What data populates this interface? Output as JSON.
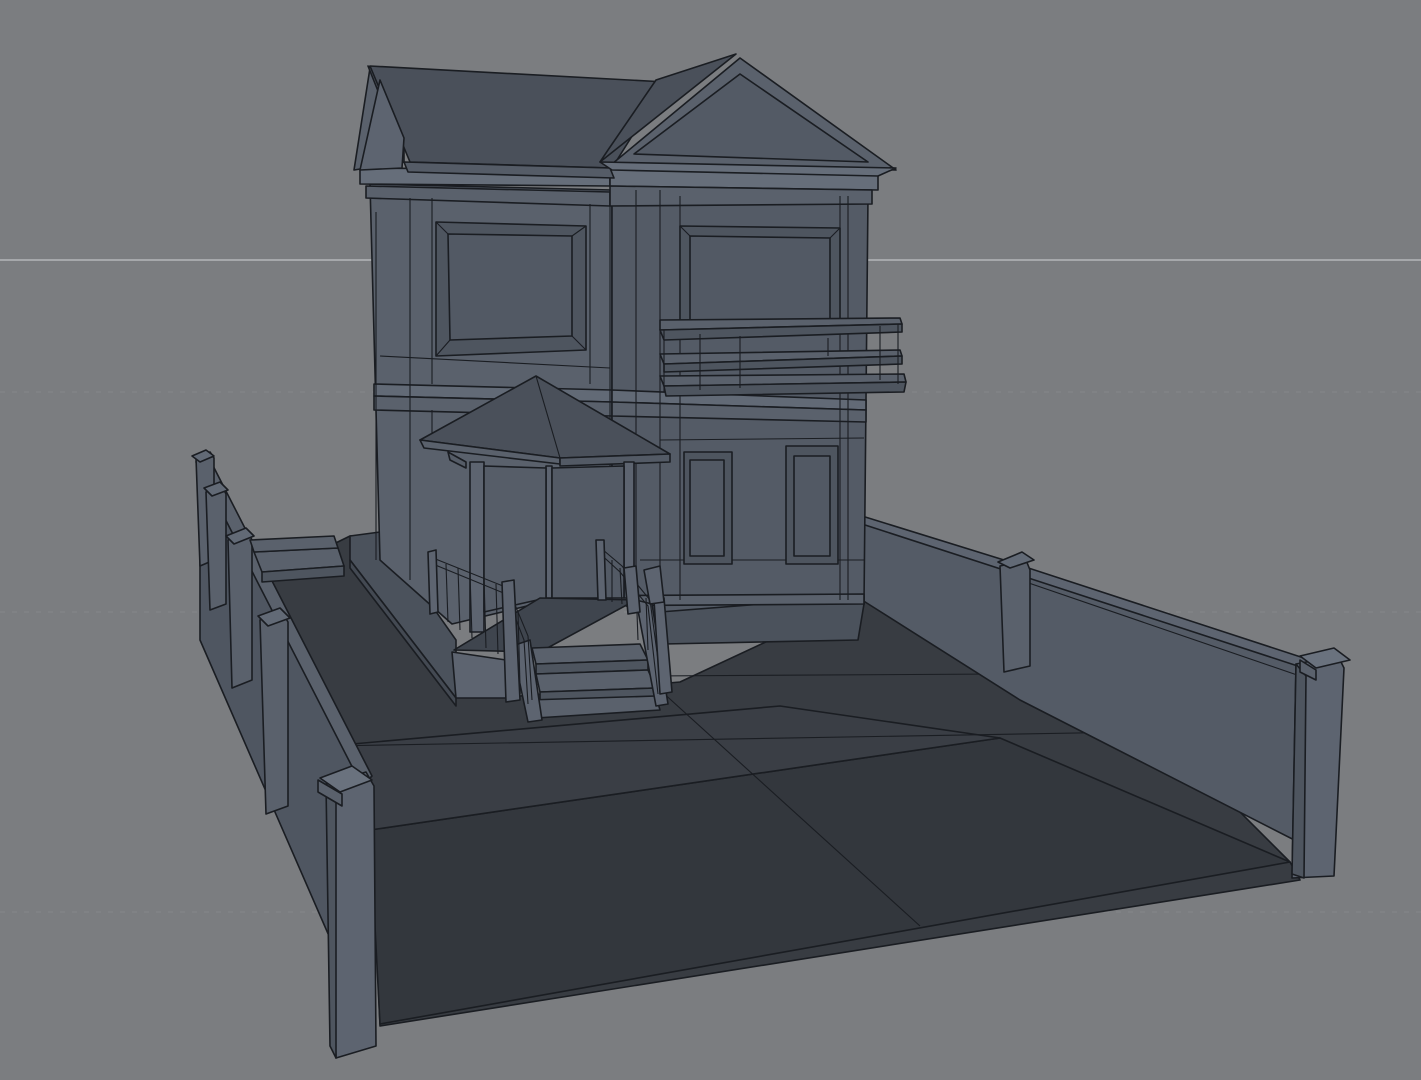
{
  "viewport": {
    "view": "perspective",
    "shading": "gouraud-lines",
    "colors": {
      "background": "#7b7d80",
      "horizon_line": "#a6a8ab",
      "grid_line": "#86888b",
      "wall_light": "#5b6370",
      "wall_mid": "#525964",
      "wall_dark": "#474d57",
      "roof": "#4a505a",
      "ground": "#33373d",
      "ground_far": "#2f3338",
      "edge": "#1a1d22"
    }
  },
  "scene": {
    "objects": [
      "house-body",
      "main-roof",
      "front-gable",
      "porch-roof",
      "porch",
      "front-steps",
      "porch-railing",
      "balcony",
      "windows",
      "yard-ground",
      "fence-wall",
      "fence-posts"
    ]
  }
}
